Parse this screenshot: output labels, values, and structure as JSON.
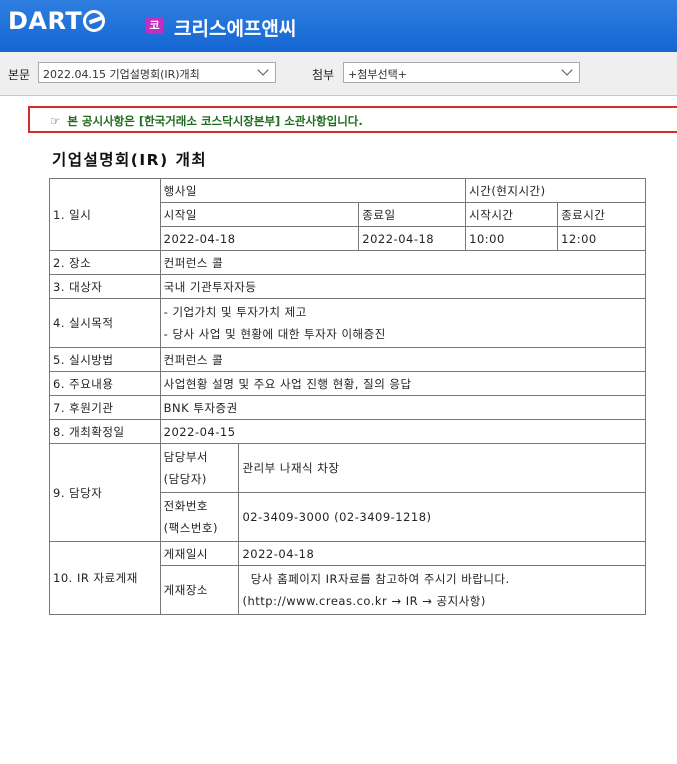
{
  "header": {
    "logo_text": "DART",
    "corp_badge": "코",
    "corp_name": "크리스에프앤씨",
    "bg_color": "#1466d2"
  },
  "selectbar": {
    "doc_label": "본문",
    "doc_value": "2022.04.15  기업설명회(IR)개최",
    "attach_label": "첨부",
    "attach_value": "+첨부선택+"
  },
  "notice": {
    "icon": "☞",
    "text": "본 공시사항은 [한국거래소 코스닥시장본부] 소관사항입니다."
  },
  "document": {
    "title": "기업설명회(IR) 개최",
    "rows": {
      "date_label": "1. 일시",
      "event_date_header": "행사일",
      "time_header": "시간(현지시간)",
      "start_date_header": "시작일",
      "end_date_header": "종료일",
      "start_time_header": "시작시간",
      "end_time_header": "종료시간",
      "start_date": "2022-04-18",
      "end_date": "2022-04-18",
      "start_time": "10:00",
      "end_time": "12:00",
      "place_label": "2. 장소",
      "place_value": "컨퍼런스 콜",
      "target_label": "3. 대상자",
      "target_value": "국내 기관투자자등",
      "purpose_label": "4. 실시목적",
      "purpose_line1": "- 기업가치 및 투자가치 제고",
      "purpose_line2": "- 당사 사업 및 현황에 대한 투자자 이해증진",
      "method_label": "5. 실시방법",
      "method_value": "컨퍼런스 콜",
      "content_label": "6. 주요내용",
      "content_value": "사업현황 설명 및 주요 사업 진행 현황, 질의 응답",
      "sponsor_label": "7. 후원기관",
      "sponsor_value": "BNK 투자증권",
      "confirm_label": "8. 개최확정일",
      "confirm_value": "2022-04-15",
      "contact_label": "9. 담당자",
      "dept_label_1": "담당부서",
      "dept_label_2": "(담당자)",
      "dept_value": "관리부 나재식 차장",
      "phone_label_1": "전화번호",
      "phone_label_2": "(팩스번호)",
      "phone_value": "02-3409-3000 (02-3409-1218)",
      "ir_label": "10. IR 자료게재",
      "post_date_label": "게재일시",
      "post_date_value": "2022-04-18",
      "post_place_label": "게재장소",
      "post_place_line1": "  당사 홈페이지 IR자료를 참고하여 주시기 바랍니다.",
      "post_place_line2": "(http://www.creas.co.kr → IR → 공지사항)"
    }
  }
}
